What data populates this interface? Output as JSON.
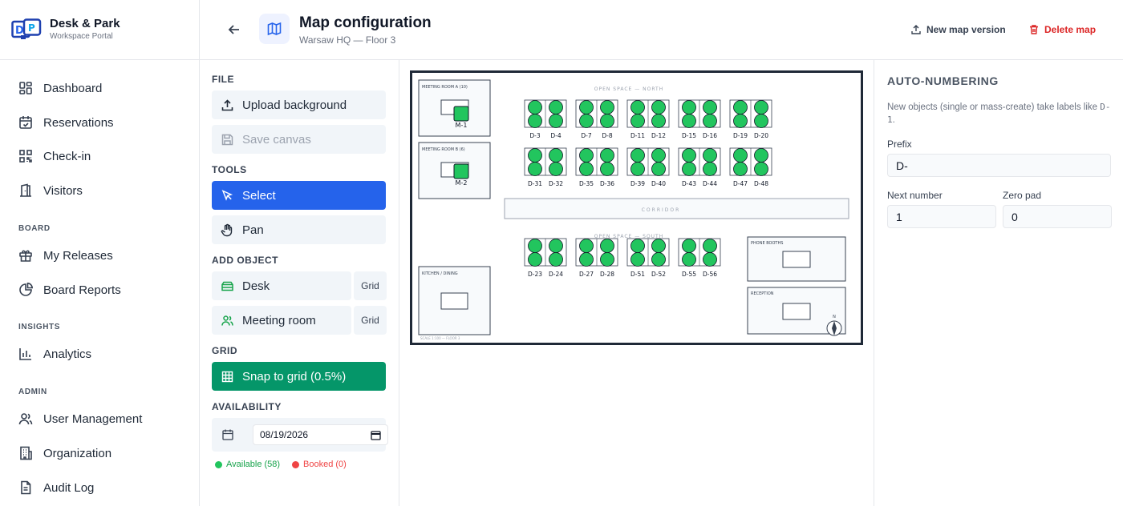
{
  "brand": {
    "name": "Desk & Park",
    "subtitle": "Workspace Portal"
  },
  "sidebar": {
    "items": [
      {
        "label": "Dashboard",
        "icon": "dashboard-icon"
      },
      {
        "label": "Reservations",
        "icon": "calendar-check-icon"
      },
      {
        "label": "Check-in",
        "icon": "qr-code-icon"
      },
      {
        "label": "Visitors",
        "icon": "door-icon"
      }
    ],
    "board_label": "BOARD",
    "board_items": [
      {
        "label": "My Releases",
        "icon": "gift-icon"
      },
      {
        "label": "Board Reports",
        "icon": "pie-chart-icon"
      }
    ],
    "insights_label": "INSIGHTS",
    "insights_items": [
      {
        "label": "Analytics",
        "icon": "bar-chart-icon"
      }
    ],
    "admin_label": "ADMIN",
    "admin_items": [
      {
        "label": "User Management",
        "icon": "users-icon"
      },
      {
        "label": "Organization",
        "icon": "building-icon"
      },
      {
        "label": "Audit Log",
        "icon": "file-text-icon"
      }
    ]
  },
  "header": {
    "title": "Map configuration",
    "subtitle": "Warsaw HQ — Floor 3",
    "new_version": "New map version",
    "delete_map": "Delete map"
  },
  "tools": {
    "file_label": "FILE",
    "upload": "Upload background",
    "save": "Save canvas",
    "tools_label": "TOOLS",
    "select": "Select",
    "pan": "Pan",
    "add_label": "ADD OBJECT",
    "desk": "Desk",
    "meeting_room": "Meeting room",
    "grid_chip": "Grid",
    "grid_label": "GRID",
    "snap": "Snap to grid (0.5%)",
    "availability_label": "AVAILABILITY",
    "date": "08/19/2026",
    "available": "Available (58)",
    "booked": "Booked (0)"
  },
  "colors": {
    "primary": "#2563eb",
    "success": "#059669",
    "available": "#22c55e",
    "booked": "#ef4444",
    "danger": "#dc2626"
  },
  "floorplan": {
    "room_a": "MEETING ROOM A (10)",
    "room_b": "MEETING ROOM B (6)",
    "kitchen": "KITCHEN / DINING",
    "north": "OPEN SPACE — NORTH",
    "south": "OPEN SPACE — SOUTH",
    "corridor": "CORRIDOR",
    "phone": "PHONE BOOTHS",
    "reception": "RECEPTION",
    "scale": "SCALE 1:100 — FLOOR 3",
    "compass": "N",
    "m1": "M-1",
    "m2": "M-2",
    "north_row1": [
      "D-3",
      "D-4",
      "D-7",
      "D-8",
      "D-11",
      "D-12",
      "D-15",
      "D-16",
      "D-19",
      "D-20"
    ],
    "north_row2": [
      "D-31",
      "D-32",
      "D-35",
      "D-36",
      "D-39",
      "D-40",
      "D-43",
      "D-44",
      "D-47",
      "D-48"
    ],
    "south_row": [
      "D-23",
      "D-24",
      "D-27",
      "D-28",
      "D-51",
      "D-52",
      "D-55",
      "D-56"
    ]
  },
  "auto": {
    "title": "AUTO-NUMBERING",
    "help": "New objects (single or mass-create) take labels like",
    "help_code": "D-1",
    "prefix_label": "Prefix",
    "prefix_value": "D-",
    "next_label": "Next number",
    "next_value": "1",
    "pad_label": "Zero pad",
    "pad_value": "0"
  }
}
